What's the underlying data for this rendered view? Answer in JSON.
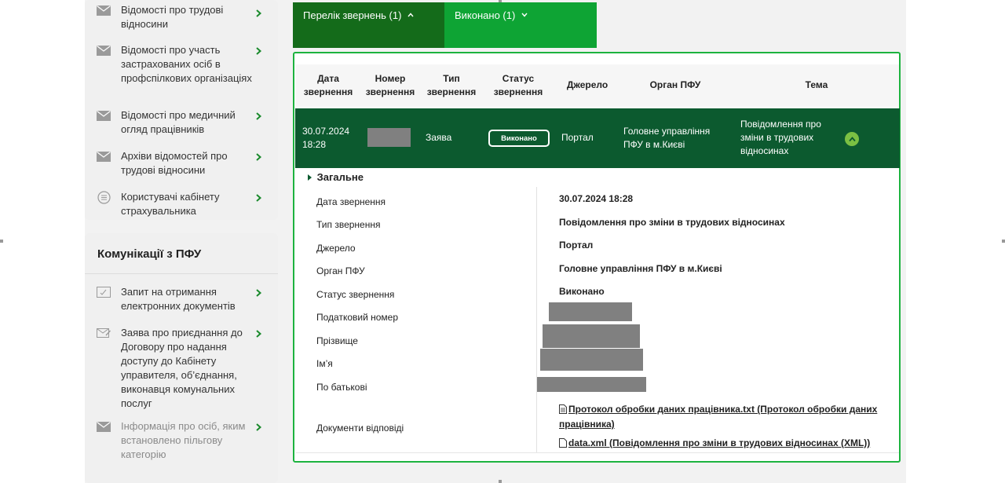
{
  "sidebar": {
    "menu_items": [
      {
        "label": "Відомості про трудові відносини",
        "icon": "envelope-icon"
      },
      {
        "label": "Відомості про участь застрахованих осіб в профспілкових організаціях",
        "icon": "envelope-icon"
      },
      {
        "label": "Відомості про медичний огляд працівників",
        "icon": "envelope-icon"
      },
      {
        "label": "Архіви відомостей про трудові відносини",
        "icon": "envelope-icon"
      },
      {
        "label": "Користувачі кабінету страхувальника",
        "icon": "list-circle-icon"
      }
    ],
    "section_title": "Комунікації з ПФУ",
    "comm_items": [
      {
        "label": "Запит на отримання електронних документів",
        "icon": "document-request-icon"
      },
      {
        "label": "Заява про приєднання до Договору про надання доступу до Кабінету управителя, об’єднання, виконавця комунальних послуг",
        "icon": "envelope-pen-icon"
      },
      {
        "label": "Інформація про осіб, яким встановлено пільгову категорію",
        "icon": "envelope-icon"
      }
    ]
  },
  "tabs": {
    "requests": "Перелік звернень (1)",
    "done": "Виконано (1)"
  },
  "table": {
    "headers": {
      "date": "Дата звернення",
      "number": "Номер звернення",
      "type": "Тип звернення",
      "status": "Статус звернення",
      "source": "Джерело",
      "organ": "Орган ПФУ",
      "topic": "Тема"
    },
    "row": {
      "date": "30.07.2024",
      "time": "18:28",
      "type": "Заява",
      "status": "Виконано",
      "source": "Портал",
      "organ": "Головне управління ПФУ в м.Києві",
      "topic": "Повідомлення про зміни в трудових відносинах"
    }
  },
  "details": {
    "section_title": "Загальне",
    "labels": {
      "date": "Дата звернення",
      "type": "Тип звернення",
      "source": "Джерело",
      "organ": "Орган ПФУ",
      "status": "Статус звернення",
      "tax_number": "Податковий номер",
      "surname": "Прізвище",
      "name": "Ім’я",
      "patronymic": "По батькові",
      "documents": "Документи відповіді"
    },
    "values": {
      "date": "30.07.2024 18:28",
      "type": "Повідомлення про зміни в трудових відносинах",
      "source": "Портал",
      "organ": "Головне управління ПФУ в м.Києві",
      "status": "Виконано"
    },
    "documents": [
      {
        "label": "Протокол обробки даних працівника.txt (Протокол обробки даних працівника)",
        "icon": "text-file-icon"
      },
      {
        "label": "data.xml (Повідомлення про зміни в трудових відносинах (XML))",
        "icon": "file-icon"
      }
    ]
  },
  "colors": {
    "tab_active": "#146b1a",
    "tab_inactive": "#0ea434",
    "row_highlight": "#0c5a2f",
    "panel_border": "#1db33f",
    "accent_chevron": "#1a8a2c"
  }
}
